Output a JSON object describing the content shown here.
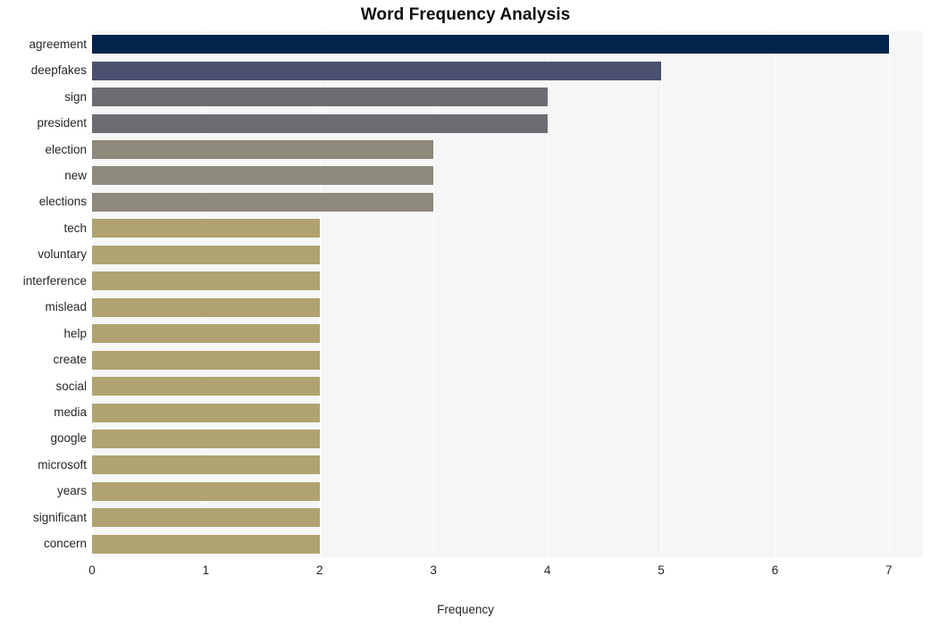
{
  "chart_data": {
    "type": "bar",
    "orientation": "horizontal",
    "title": "Word Frequency Analysis",
    "xlabel": "Frequency",
    "ylabel": "",
    "xlim": [
      0,
      7.3
    ],
    "xticks": [
      0,
      1,
      2,
      3,
      4,
      5,
      6,
      7
    ],
    "xtick_labels": [
      "0",
      "1",
      "2",
      "3",
      "4",
      "5",
      "6",
      "7"
    ],
    "grid": "vertical",
    "legend": "none",
    "categories": [
      "agreement",
      "deepfakes",
      "sign",
      "president",
      "election",
      "new",
      "elections",
      "tech",
      "voluntary",
      "interference",
      "mislead",
      "help",
      "create",
      "social",
      "media",
      "google",
      "microsoft",
      "years",
      "significant",
      "concern"
    ],
    "values": [
      7,
      5,
      4,
      4,
      3,
      3,
      3,
      2,
      2,
      2,
      2,
      2,
      2,
      2,
      2,
      2,
      2,
      2,
      2,
      2
    ],
    "bar_colors": [
      "#03234d",
      "#4b5270",
      "#6b6d72",
      "#6b6d72",
      "#8d8a7c",
      "#8d8a7c",
      "#8d8a7c",
      "#b0a371",
      "#b0a371",
      "#b0a371",
      "#b0a371",
      "#b0a371",
      "#b0a371",
      "#b0a371",
      "#b0a371",
      "#b0a371",
      "#b0a371",
      "#b0a371",
      "#b0a371",
      "#b0a371"
    ]
  },
  "style": {
    "plot_background": "#f6f6f6",
    "figure_background": "#ffffff",
    "gridline_color": "#ffffff",
    "text_color": "#262626",
    "title_color": "#0d0d0d"
  }
}
